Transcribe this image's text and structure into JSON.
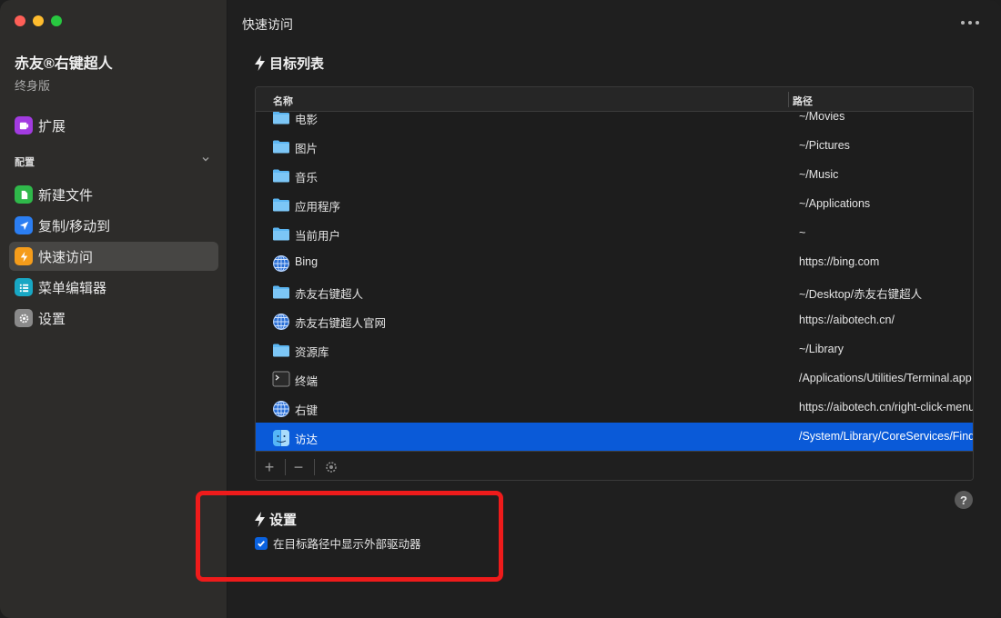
{
  "sidebar": {
    "app_name": "赤友®右键超人",
    "edition": "终身版",
    "extensions_label": "扩展",
    "section_label": "配置",
    "items": [
      {
        "label": "新建文件"
      },
      {
        "label": "复制/移动到"
      },
      {
        "label": "快速访问"
      },
      {
        "label": "菜单编辑器"
      },
      {
        "label": "设置"
      }
    ],
    "active_item": "快速访问"
  },
  "main": {
    "title": "快速访问",
    "target_list_heading": "目标列表",
    "columns": {
      "name": "名称",
      "path": "路径"
    },
    "rows": [
      {
        "name": "电影",
        "path": "~/Movies",
        "icon": "folder-movies-icon"
      },
      {
        "name": "图片",
        "path": "~/Pictures",
        "icon": "folder-pictures-icon"
      },
      {
        "name": "音乐",
        "path": "~/Music",
        "icon": "folder-music-icon"
      },
      {
        "name": "应用程序",
        "path": "~/Applications",
        "icon": "folder-apps-icon"
      },
      {
        "name": "当前用户",
        "path": "~",
        "icon": "folder-home-icon"
      },
      {
        "name": "Bing",
        "path": "https://bing.com",
        "icon": "globe-icon"
      },
      {
        "name": "赤友右键超人",
        "path": "~/Desktop/赤友右键超人",
        "icon": "folder-icon"
      },
      {
        "name": "赤友右键超人官网",
        "path": "https://aibotech.cn/",
        "icon": "globe-icon"
      },
      {
        "name": "资源库",
        "path": "~/Library",
        "icon": "folder-library-icon"
      },
      {
        "name": "终端",
        "path": "/Applications/Utilities/Terminal.app",
        "icon": "terminal-icon"
      },
      {
        "name": "右键",
        "path": "https://aibotech.cn/right-click-menu",
        "icon": "globe-icon"
      },
      {
        "name": "访达",
        "path": "/System/Library/CoreServices/Finder.app",
        "icon": "finder-icon"
      }
    ],
    "selected_row": "访达",
    "toolbar": {
      "add": "+",
      "remove": "−"
    },
    "settings_heading": "设置",
    "checkbox_label": "在目标路径中显示外部驱动器",
    "checkbox_checked": true,
    "help_label": "?"
  },
  "colors": {
    "accent": "#0a5ad8",
    "highlight_box": "#ee1b1b",
    "sidebar_bg": "#2d2c2a",
    "main_bg": "#1f1f1f"
  }
}
